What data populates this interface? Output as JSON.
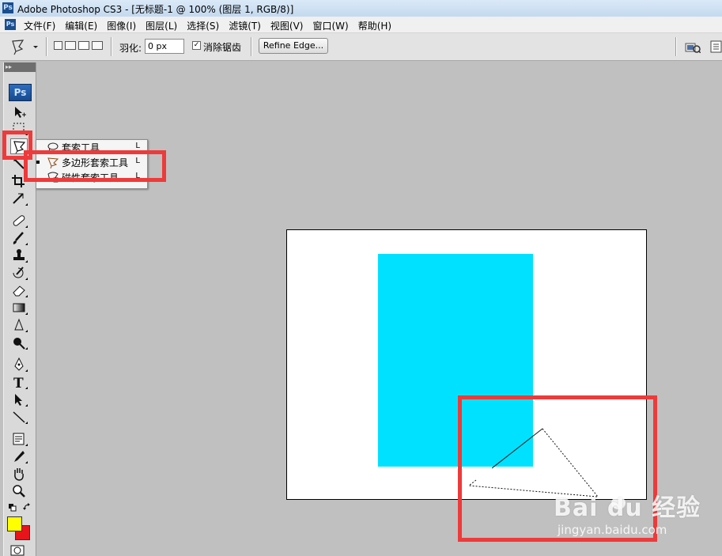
{
  "window": {
    "title": "Adobe Photoshop CS3 - [无标题-1 @ 100% (图层 1, RGB/8)]",
    "app_badge": "Ps"
  },
  "menu": {
    "items": [
      {
        "label": "文件(F)"
      },
      {
        "label": "编辑(E)"
      },
      {
        "label": "图像(I)"
      },
      {
        "label": "图层(L)"
      },
      {
        "label": "选择(S)"
      },
      {
        "label": "滤镜(T)"
      },
      {
        "label": "视图(V)"
      },
      {
        "label": "窗口(W)"
      },
      {
        "label": "帮助(H)"
      }
    ]
  },
  "options": {
    "feather_label": "羽化:",
    "feather_value": "0 px",
    "antialias_checked": true,
    "antialias_label": "消除锯齿",
    "refine_edge_label": "Refine Edge..."
  },
  "toolbox": {
    "logo": "Ps",
    "colors": {
      "foreground": "#ffff00",
      "background": "#e8141c"
    }
  },
  "flyout": {
    "items": [
      {
        "label": "套索工具",
        "shortcut": "L",
        "icon": "lasso-icon",
        "selected": false
      },
      {
        "label": "多边形套索工具",
        "shortcut": "L",
        "icon": "polygonal-lasso-icon",
        "selected": true
      },
      {
        "label": "磁性套索工具",
        "shortcut": "L",
        "icon": "magnetic-lasso-icon",
        "selected": false
      }
    ]
  },
  "document": {
    "canvas_color": "#ffffff",
    "shape_color": "#00e1ff"
  },
  "annotation_color": "#ee3a3a",
  "watermark": {
    "logo": "Bai du 经验",
    "url": "jingyan.baidu.com"
  }
}
